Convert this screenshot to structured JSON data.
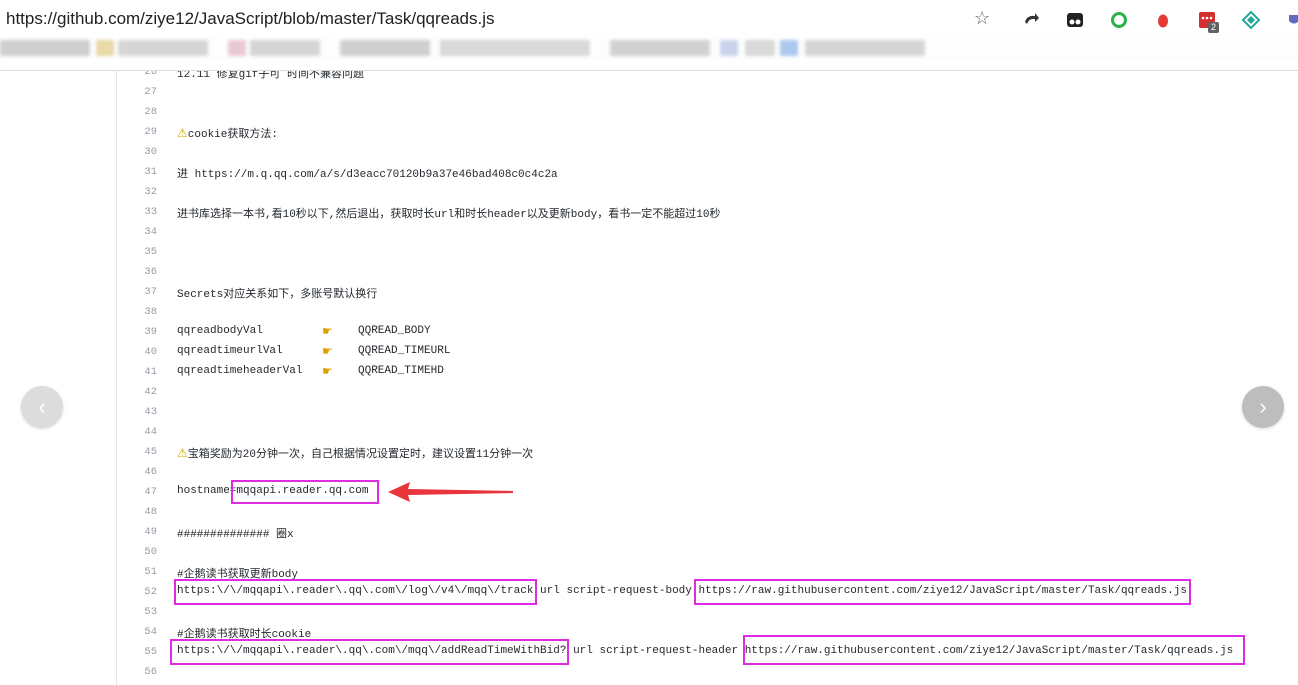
{
  "browser": {
    "url": "https://github.com/ziye12/JavaScript/blob/master/Task/qqreads.js",
    "extension_badge": "2"
  },
  "code": {
    "top_partial": "12.11 修复gif子可 时间不兼容问题",
    "lines": [
      {
        "num": "27",
        "text": ""
      },
      {
        "num": "28",
        "text": ""
      },
      {
        "num": "29",
        "text": "cookie获取方法:",
        "warn": true
      },
      {
        "num": "30",
        "text": ""
      },
      {
        "num": "31",
        "text": "进 https://m.q.qq.com/a/s/d3eacc70120b9a37e46bad408c0c4c2a"
      },
      {
        "num": "32",
        "text": ""
      },
      {
        "num": "33",
        "text": "进书库选择一本书,看10秒以下,然后退出，获取时长url和时长header以及更新body，看书一定不能超过10秒"
      },
      {
        "num": "34",
        "text": ""
      },
      {
        "num": "35",
        "text": ""
      },
      {
        "num": "36",
        "text": ""
      },
      {
        "num": "37",
        "text": "Secrets对应关系如下，多账号默认换行"
      },
      {
        "num": "38",
        "text": ""
      },
      {
        "num": "39",
        "text": "qqreadbodyVal",
        "hand": true,
        "right": "QQREAD_BODY"
      },
      {
        "num": "40",
        "text": "qqreadtimeurlVal",
        "hand": true,
        "right": "QQREAD_TIMEURL"
      },
      {
        "num": "41",
        "text": "qqreadtimeheaderVal",
        "hand": true,
        "right": "QQREAD_TIMEHD"
      },
      {
        "num": "42",
        "text": ""
      },
      {
        "num": "43",
        "text": ""
      },
      {
        "num": "44",
        "text": ""
      },
      {
        "num": "45",
        "text": "宝箱奖励为20分钟一次，自己根据情况设置定时，建议设置11分钟一次",
        "warn": true
      },
      {
        "num": "46",
        "text": ""
      },
      {
        "num": "47",
        "text": "hostname=mqqapi.reader.qq.com"
      },
      {
        "num": "48",
        "text": ""
      },
      {
        "num": "49",
        "text": "############## 圈x"
      },
      {
        "num": "50",
        "text": ""
      },
      {
        "num": "51",
        "text": "#企鹅读书获取更新body"
      },
      {
        "num": "52",
        "text": "https:\\/\\/mqqapi\\.reader\\.qq\\.com\\/log\\/v4\\/mqq\\/track url script-request-body https://raw.githubusercontent.com/ziye12/JavaScript/master/Task/qqreads.js"
      },
      {
        "num": "53",
        "text": ""
      },
      {
        "num": "54",
        "text": "#企鹅读书获取时长cookie"
      },
      {
        "num": "55",
        "text": "https:\\/\\/mqqapi\\.reader\\.qq\\.com\\/mqq\\/addReadTimeWithBid? url script-request-header https://raw.githubusercontent.com/ziye12/JavaScript/master/Task/qqreads.js"
      },
      {
        "num": "56",
        "text": ""
      }
    ]
  },
  "nav": {
    "prev_glyph": "‹",
    "next_glyph": "›"
  },
  "colors": {
    "highlight": "#e02ce0",
    "arrow": "#e8343a"
  }
}
